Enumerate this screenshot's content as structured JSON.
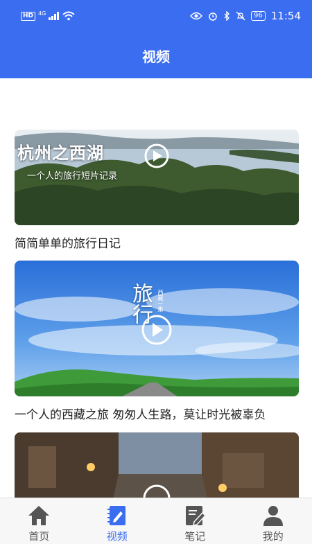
{
  "status_bar": {
    "network": "HD",
    "signal": "4G",
    "battery": "96",
    "time": "11:54"
  },
  "header": {
    "title": "视频"
  },
  "videos": [
    {
      "overlay_title": "杭州之西湖",
      "overlay_subtitle": "一个人的旅行短片记录",
      "caption": "简简单单的旅行日记"
    },
    {
      "overlay_title": "旅行",
      "overlay_side_text": "西藏一集",
      "caption": "一个人的西藏之旅 匆匆人生路，莫让时光被辜负"
    },
    {
      "caption": ""
    }
  ],
  "bottom_nav": {
    "items": [
      {
        "label": "首页",
        "icon": "home-icon"
      },
      {
        "label": "视频",
        "icon": "video-notebook-icon",
        "active": true
      },
      {
        "label": "笔记",
        "icon": "note-edit-icon"
      },
      {
        "label": "我的",
        "icon": "person-icon"
      }
    ]
  },
  "colors": {
    "accent": "#3b6df0"
  }
}
